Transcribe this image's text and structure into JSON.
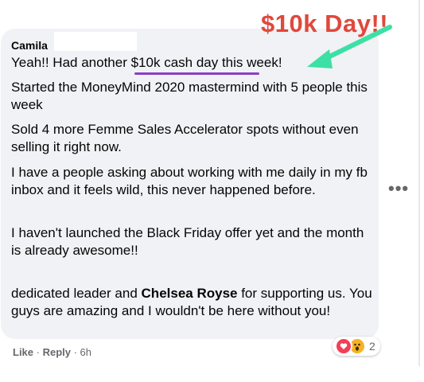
{
  "annotation": {
    "title": "$10k Day!!",
    "color": "#e0483c",
    "arrow_color": "#3ce0a4",
    "underline_color": "#8a3fc4"
  },
  "comment": {
    "author": "Camila",
    "paragraphs": [
      "Yeah!! Had another $10k cash day this week!",
      "Started the MoneyMind 2020 mastermind with 5 people this week",
      "Sold 4 more Femme Sales Accelerator spots without even selling it right now.",
      "I have a people asking about working with me daily in my fb inbox and it feels wild, this never happened before.",
      "I haven't launched the Black Friday offer yet and the month is already awesome!!"
    ],
    "closing": {
      "before": "dedicated leader and ",
      "mention": "Chelsea Royse",
      "after": " for supporting us. You guys are amazing and I wouldn't be here without you!"
    }
  },
  "actions": {
    "like": "Like",
    "separator": " · ",
    "reply": "Reply",
    "time": "6h"
  },
  "reactions": {
    "icons": [
      "heart-icon",
      "wow-icon"
    ],
    "count": "2"
  },
  "menu": {
    "more_label": "•••"
  }
}
